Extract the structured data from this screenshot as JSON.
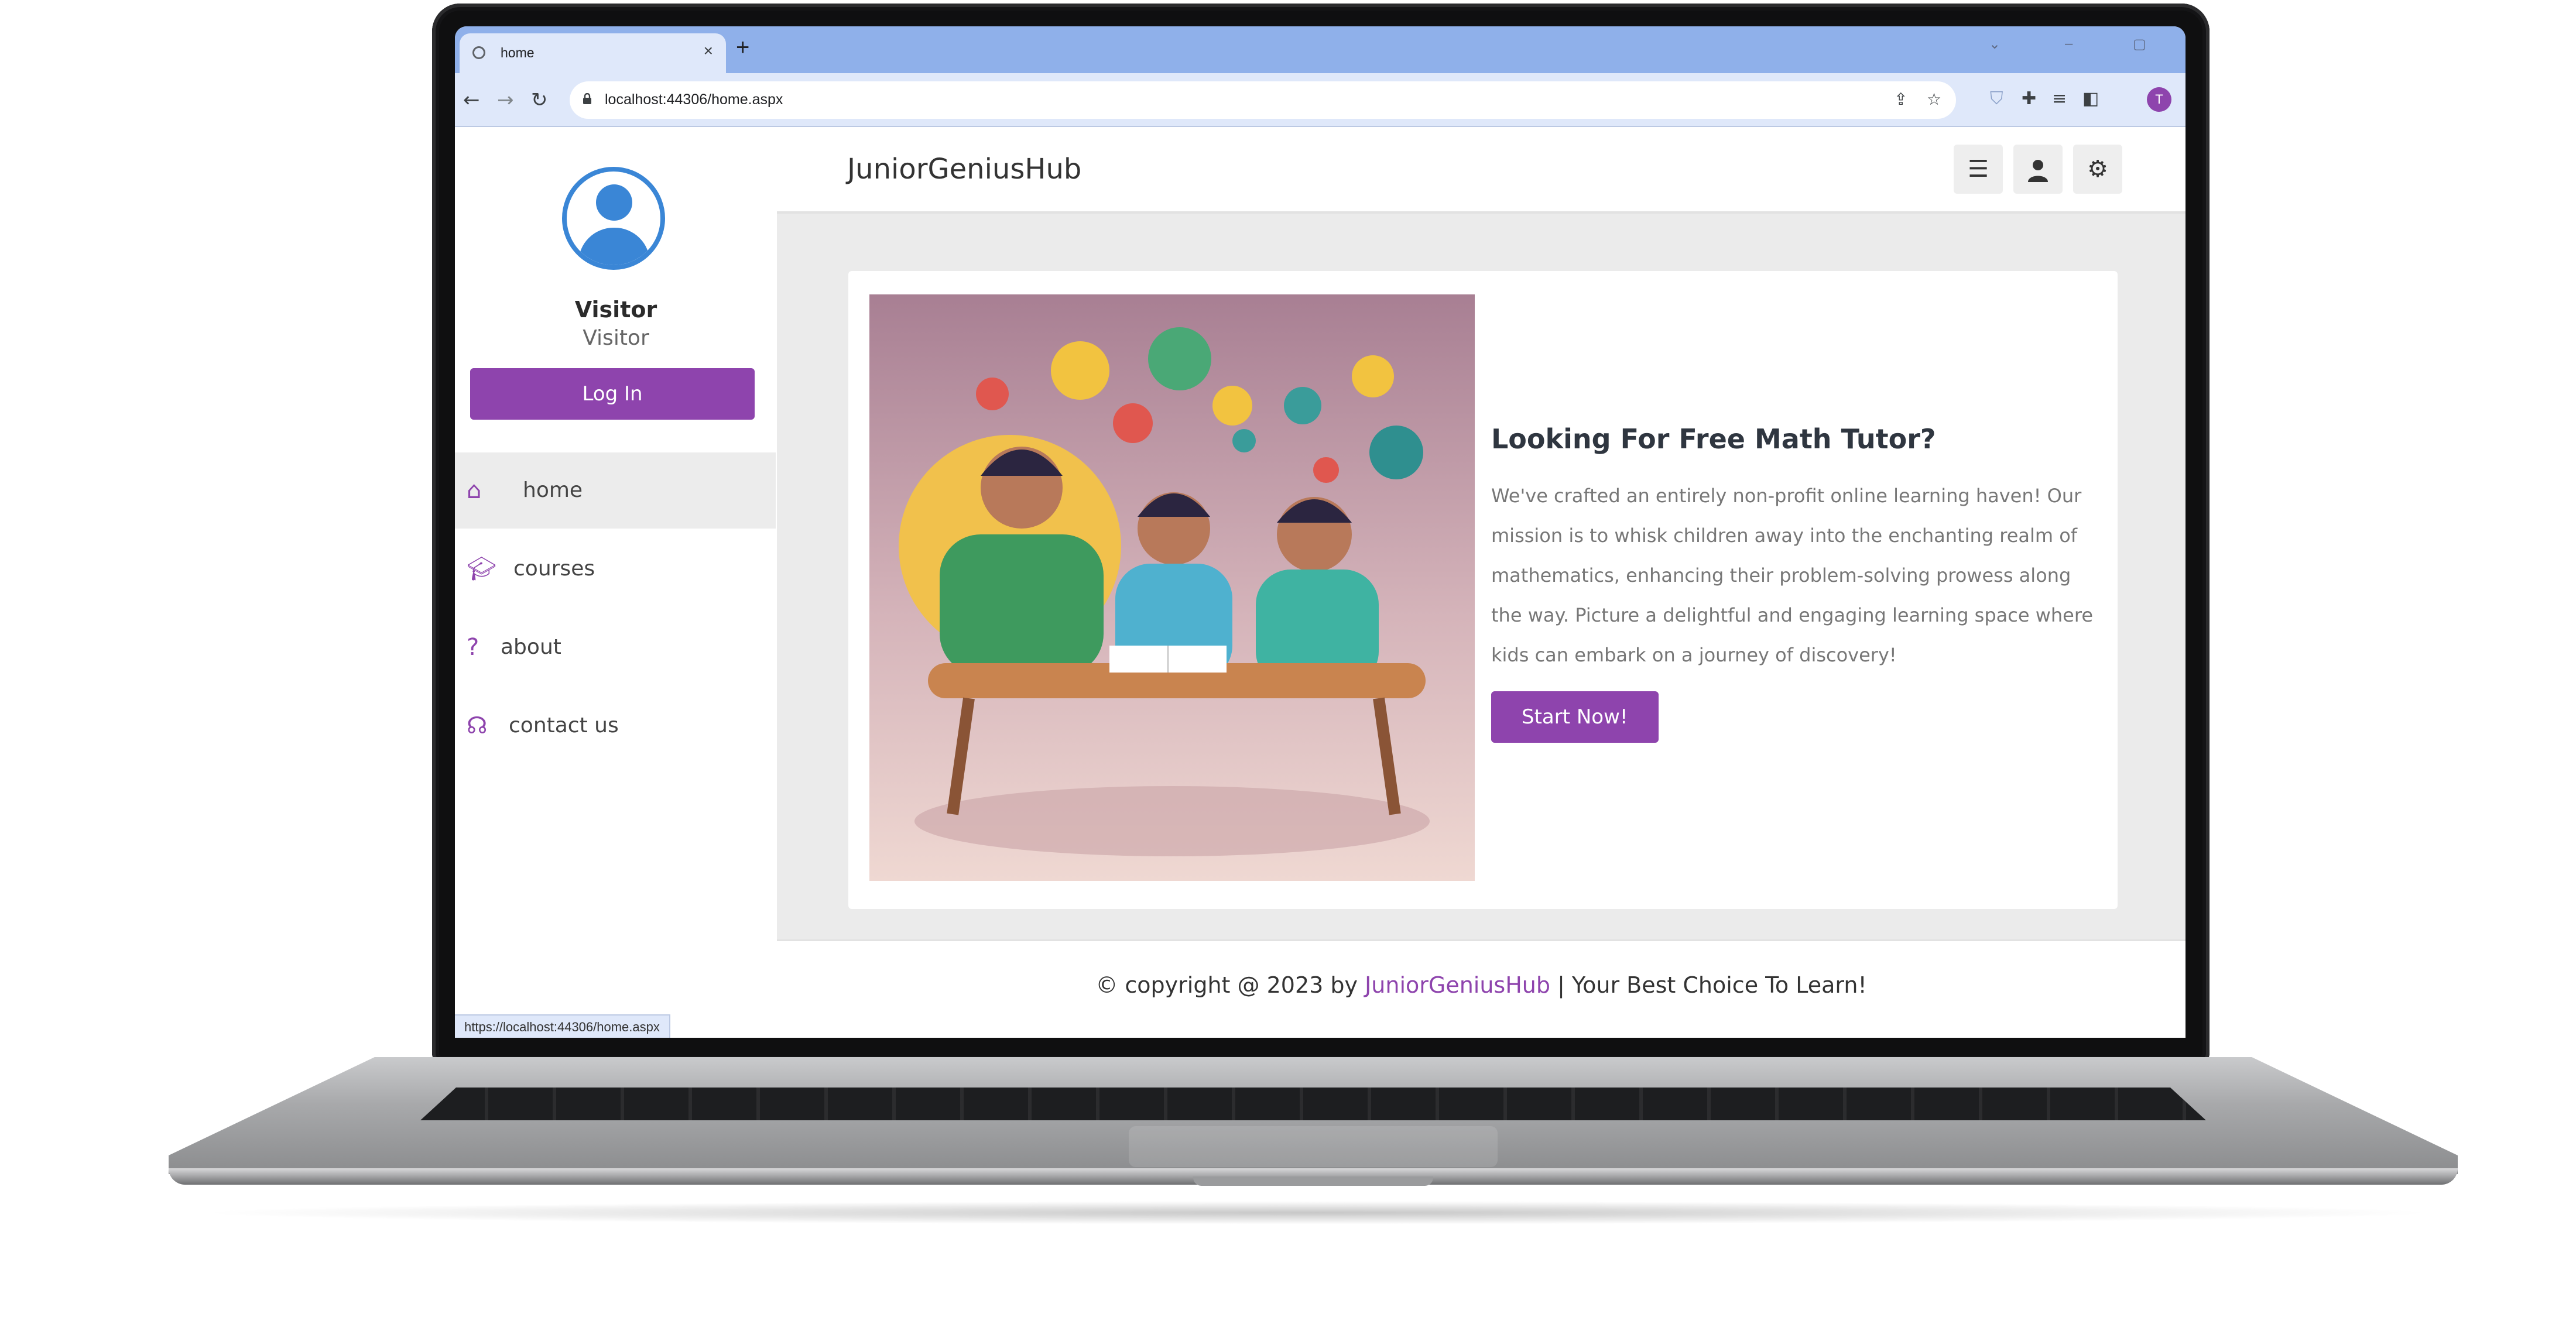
{
  "browser": {
    "tab_title": "home",
    "tab_close": "×",
    "new_tab": "+",
    "url": "localhost:44306/home.aspx",
    "profile_initial": "T",
    "status_url": "https://localhost:44306/home.aspx"
  },
  "sidebar": {
    "user_name": "Visitor",
    "user_role": "Visitor",
    "login_label": "Log In",
    "items": [
      {
        "label": "home",
        "icon": "home-icon",
        "active": true
      },
      {
        "label": "courses",
        "icon": "graduation-cap-icon",
        "active": false
      },
      {
        "label": "about",
        "icon": "question-icon",
        "active": false
      },
      {
        "label": "contact us",
        "icon": "headset-icon",
        "active": false
      }
    ]
  },
  "header": {
    "brand": "JuniorGeniusHub",
    "buttons": [
      "menu-icon",
      "user-icon",
      "settings-icon"
    ]
  },
  "card": {
    "heading": "Looking For Free Math Tutor?",
    "body": "We've crafted an entirely non-profit online learning haven! Our mission is to whisk children away into the enchanting realm of mathematics, enhancing their problem-solving prowess along the way. Picture a delightful and engaging learning space where kids can embark on a journey of discovery!",
    "cta": "Start Now!"
  },
  "footer": {
    "prefix": "© copyright @ 2023 by ",
    "brand": "JuniorGeniusHub",
    "suffix": " | Your Best Choice To Learn!"
  },
  "colors": {
    "accent": "#8e44ad",
    "avatar": "#3a86d6",
    "content_bg": "#ebebeb",
    "tabstrip": "#8fb0ea"
  }
}
